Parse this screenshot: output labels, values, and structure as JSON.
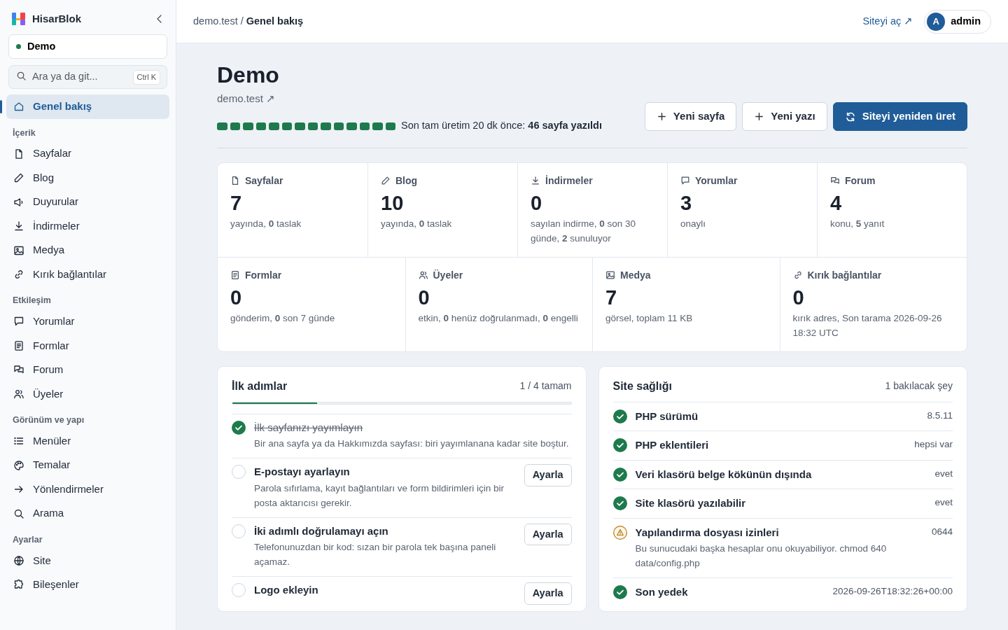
{
  "brand": {
    "name": "HisarBlok"
  },
  "site_switcher": {
    "label": "Demo"
  },
  "search": {
    "placeholder": "Ara ya da git...",
    "shortcut": "Ctrl K"
  },
  "sidebar": {
    "top_items": [
      {
        "label": "Genel bakış",
        "selected": true
      }
    ],
    "sections": [
      {
        "title": "İçerik",
        "items": [
          {
            "label": "Sayfalar",
            "selected": false
          },
          {
            "label": "Blog",
            "selected": false
          },
          {
            "label": "Duyurular",
            "selected": false
          },
          {
            "label": "İndirmeler",
            "selected": false
          },
          {
            "label": "Medya",
            "selected": false
          },
          {
            "label": "Kırık bağlantılar",
            "selected": false
          }
        ]
      },
      {
        "title": "Etkileşim",
        "items": [
          {
            "label": "Yorumlar",
            "selected": false
          },
          {
            "label": "Formlar",
            "selected": false
          },
          {
            "label": "Forum",
            "selected": false
          },
          {
            "label": "Üyeler",
            "selected": false
          }
        ]
      },
      {
        "title": "Görünüm ve yapı",
        "items": [
          {
            "label": "Menüler",
            "selected": false
          },
          {
            "label": "Temalar",
            "selected": false
          },
          {
            "label": "Yönlendirmeler",
            "selected": false
          },
          {
            "label": "Arama",
            "selected": false
          }
        ]
      },
      {
        "title": "Ayarlar",
        "items": [
          {
            "label": "Site",
            "selected": false
          },
          {
            "label": "Bileşenler",
            "selected": false
          }
        ]
      }
    ]
  },
  "breadcrumb": {
    "parent": "demo.test",
    "separator": "/",
    "current": "Genel bakış"
  },
  "top_bar": {
    "site_link": "Siteyi aç ↗",
    "user": {
      "initial": "A",
      "name": "admin"
    }
  },
  "header": {
    "title": "Demo",
    "url": "demo.test ↗",
    "build_segments": [
      {
        "done": true
      },
      {
        "done": true
      },
      {
        "done": true
      },
      {
        "done": true
      },
      {
        "done": true
      },
      {
        "done": true
      },
      {
        "done": true
      },
      {
        "done": true
      },
      {
        "done": true
      },
      {
        "done": true
      },
      {
        "done": true
      },
      {
        "done": true
      },
      {
        "done": true
      },
      {
        "done": true
      }
    ],
    "build_text": "Son tam üretim 20 dk önce: **46 sayfa yazıldı**"
  },
  "actions": [
    {
      "label": "Yeni sayfa",
      "kind": "secondary"
    },
    {
      "label": "Yeni yazı",
      "kind": "secondary"
    },
    {
      "label": "Siteyi yeniden üret",
      "kind": "primary"
    }
  ],
  "stats": {
    "top_row": [
      {
        "title": "Sayfalar",
        "value": "7",
        "detail": "yayında, **0** taslak"
      },
      {
        "title": "Blog",
        "value": "10",
        "detail": "yayında, **0** taslak"
      },
      {
        "title": "İndirmeler",
        "value": "0",
        "detail": "sayılan indirme, **0** son 30 günde, **2** sunuluyor"
      },
      {
        "title": "Yorumlar",
        "value": "3",
        "detail": "onaylı"
      },
      {
        "title": "Forum",
        "value": "4",
        "detail": "konu, **5** yanıt"
      }
    ],
    "bottom_row": [
      {
        "title": "Formlar",
        "value": "0",
        "detail": "gönderim, **0** son 7 günde"
      },
      {
        "title": "Üyeler",
        "value": "0",
        "detail": "etkin, **0** henüz doğrulanmadı, **0** engelli"
      },
      {
        "title": "Medya",
        "value": "7",
        "detail": "görsel, toplam 11 KB"
      },
      {
        "title": "Kırık bağlantılar",
        "value": "0",
        "detail": "kırık adres, Son tarama 2026-09-26 18:32 UTC"
      }
    ]
  },
  "first_steps": {
    "title": "İlk adımlar",
    "progress_text": "1 / 4 tamam",
    "level": 0.25,
    "steps": [
      {
        "title": "İlk sayfanızı yayımlayın",
        "description": "Bir ana sayfa ya da Hakkımızda sayfası: biri yayımlanana kadar site boştur.",
        "done": true
      },
      {
        "title": "E-postayı ayarlayın",
        "description": "Parola sıfırlama, kayıt bağlantıları ve form bildirimleri için bir posta aktarıcısı gerekir.",
        "done": false,
        "action": "Ayarla"
      },
      {
        "title": "İki adımlı doğrulamayı açın",
        "description": "Telefonunuzdan bir kod: sızan bir parola tek başına paneli açamaz.",
        "done": false,
        "action": "Ayarla"
      },
      {
        "title": "Logo ekleyin",
        "done": false,
        "action": "Ayarla"
      }
    ]
  },
  "site_health": {
    "title": "Site sağlığı",
    "summary": "1 bakılacak şey",
    "checks": [
      {
        "label": "PHP sürümü",
        "value": "8.5.11",
        "warning": false
      },
      {
        "label": "PHP eklentileri",
        "value": "hepsi var",
        "warning": false
      },
      {
        "label": "Veri klasörü belge kökünün dışında",
        "value": "evet",
        "warning": false
      },
      {
        "label": "Site klasörü yazılabilir",
        "value": "evet",
        "warning": false
      },
      {
        "label": "Yapılandırma dosyası izinleri",
        "value": "0644",
        "warning": true,
        "detail": "Bu sunucudaki başka hesaplar onu okuyabiliyor. chmod 640 data/config.php"
      },
      {
        "label": "Son yedek",
        "value": "2026-09-26T18:32:26+00:00",
        "warning": false
      }
    ]
  }
}
